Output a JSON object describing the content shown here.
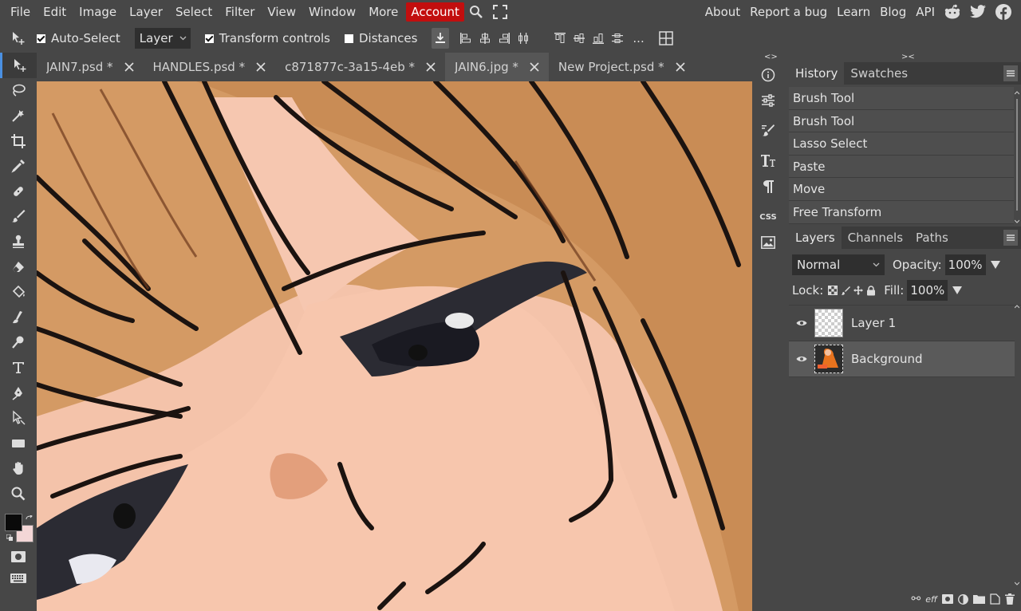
{
  "menu": {
    "items": [
      "File",
      "Edit",
      "Image",
      "Layer",
      "Select",
      "Filter",
      "View",
      "Window",
      "More"
    ],
    "account": "Account",
    "right": [
      "About",
      "Report a bug",
      "Learn",
      "Blog",
      "API"
    ]
  },
  "options": {
    "auto_select": "Auto-Select",
    "layer_select": "Layer",
    "transform_controls": "Transform controls",
    "distances": "Distances",
    "more": "..."
  },
  "tabs": [
    {
      "label": "JAIN7.psd *"
    },
    {
      "label": "HANDLES.psd *"
    },
    {
      "label": "c871877c-3a15-4eb *"
    },
    {
      "label": "JAIN6.jpg *"
    },
    {
      "label": "New Project.psd *"
    }
  ],
  "collapse": {
    "left": "<>",
    "right": "><"
  },
  "minibar": {
    "css": "CSS"
  },
  "history": {
    "tabs": [
      "History",
      "Swatches"
    ],
    "items": [
      "Brush Tool",
      "Brush Tool",
      "Lasso Select",
      "Paste",
      "Move",
      "Free Transform"
    ]
  },
  "layers": {
    "tabs": [
      "Layers",
      "Channels",
      "Paths"
    ],
    "blend_mode": "Normal",
    "opacity_label": "Opacity:",
    "opacity": "100%",
    "lock_label": "Lock:",
    "fill_label": "Fill:",
    "fill": "100%",
    "items": [
      {
        "name": "Layer 1"
      },
      {
        "name": "Background"
      }
    ],
    "bottom": {
      "link": "⚯",
      "eff": "eff"
    }
  },
  "colors": {
    "foreground": "#0a0a0a",
    "background": "#f3d6d6",
    "accent": "#c20e0e"
  }
}
